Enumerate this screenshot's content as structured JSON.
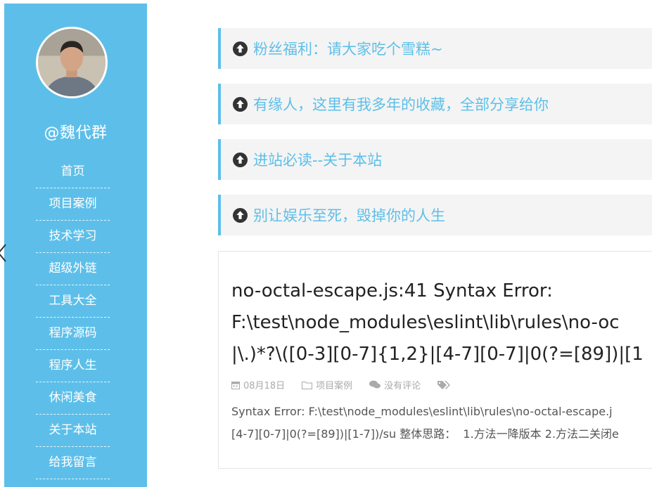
{
  "sidebar": {
    "author": "@魏代群",
    "nav": [
      {
        "label": "首页"
      },
      {
        "label": "项目案例"
      },
      {
        "label": "技术学习"
      },
      {
        "label": "超级外链"
      },
      {
        "label": "工具大全"
      },
      {
        "label": "程序源码"
      },
      {
        "label": "程序人生"
      },
      {
        "label": "休闲美食"
      },
      {
        "label": "关于本站"
      },
      {
        "label": "给我留言"
      }
    ]
  },
  "notices": [
    {
      "text": "粉丝福利：请大家吃个雪糕~",
      "icon": "arrow-circle-up-icon"
    },
    {
      "text": "有缘人，这里有我多年的收藏，全部分享给你",
      "icon": "arrow-circle-up-icon"
    },
    {
      "text": "进站必读--关于本站",
      "icon": "arrow-circle-up-icon"
    },
    {
      "text": "别让娱乐至死，毁掉你的人生",
      "icon": "arrow-circle-up-icon"
    }
  ],
  "article": {
    "title_lines": [
      "no-octal-escape.js:41 Syntax Error:",
      "F:\\test\\node_modules\\eslint\\lib\\rules\\no-oc",
      "|\\.)*?\\([0-3][0-7]{1,2}|[4-7][0-7]|0(?=[89])|[1"
    ],
    "date": "08月18日",
    "category": "项目案例",
    "comments": "没有评论",
    "excerpt_lines": [
      "Syntax Error: F:\\test\\node_modules\\eslint\\lib\\rules\\no-octal-escape.j",
      "[4-7][0-7]|0(?=[89])|[1-7])/su 整体思路：  1.方法一降版本 2.方法二关闭e"
    ]
  },
  "colors": {
    "accent": "#5dbfe9",
    "notice_bg": "#f4f4f4",
    "meta": "#aaaaaa"
  }
}
